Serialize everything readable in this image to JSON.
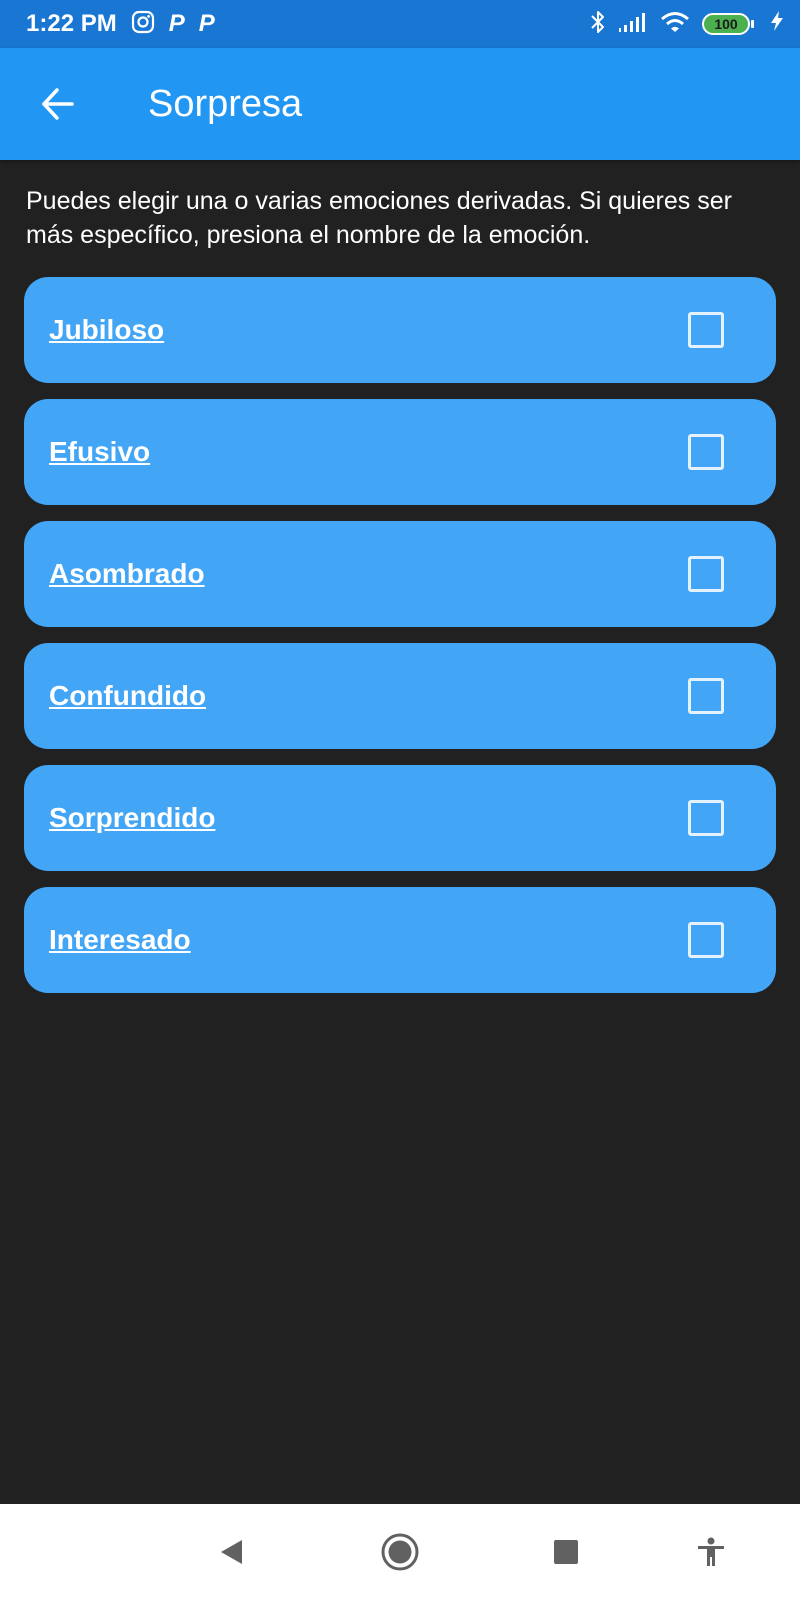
{
  "status_bar": {
    "time": "1:22 PM",
    "battery": "100",
    "left_icons": [
      "instagram-icon",
      "p-app-icon",
      "p-app-icon"
    ],
    "p_glyph": "P",
    "right_icons": [
      "bluetooth-icon",
      "signal-icon",
      "wifi-icon",
      "battery-icon",
      "charging-icon"
    ]
  },
  "app_bar": {
    "title": "Sorpresa",
    "back_icon": "arrow-back-icon"
  },
  "instructions": "Puedes elegir una o varias emociones derivadas. Si quieres ser más específico, presiona el nombre de la emoción.",
  "emotions": [
    {
      "label": "Jubiloso",
      "checked": false
    },
    {
      "label": "Efusivo",
      "checked": false
    },
    {
      "label": "Asombrado",
      "checked": false
    },
    {
      "label": "Confundido",
      "checked": false
    },
    {
      "label": "Sorprendido",
      "checked": false
    },
    {
      "label": "Interesado",
      "checked": false
    }
  ],
  "nav_bar": {
    "buttons": [
      "back-triangle-icon",
      "home-circle-icon",
      "recents-square-icon",
      "accessibility-icon"
    ]
  },
  "colors": {
    "status_bar": "#1976D2",
    "app_bar": "#2196F3",
    "background": "#212121",
    "card": "#42A5F5",
    "checkbox_border": "#E3F2FD",
    "battery": "#4CAF50",
    "nav_bar": "#FFFFFF",
    "nav_icon": "#616161"
  }
}
